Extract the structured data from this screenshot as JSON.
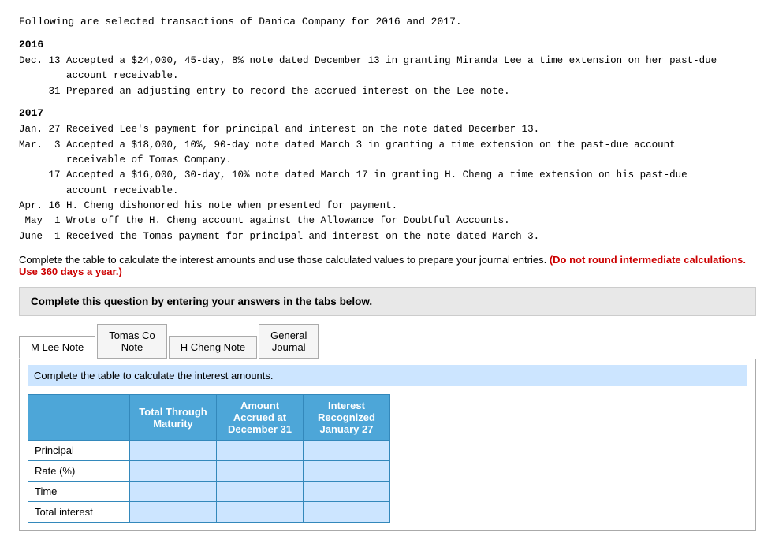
{
  "intro": "Following are selected transactions of Danica Company for 2016 and 2017.",
  "year2016": {
    "heading": "2016",
    "transactions": "Dec. 13 Accepted a $24,000, 45-day, 8% note dated December 13 in granting Miranda Lee a time extension on her past-due\n        account receivable.\n     31 Prepared an adjusting entry to record the accrued interest on the Lee note."
  },
  "year2017": {
    "heading": "2017",
    "transactions": "Jan. 27 Received Lee's payment for principal and interest on the note dated December 13.\nMar.  3 Accepted a $18,000, 10%, 90-day note dated March 3 in granting a time extension on the past-due account\n        receivable of Tomas Company.\n     17 Accepted a $16,000, 30-day, 10% note dated March 17 in granting H. Cheng a time extension on his past-due\n        account receivable.\nApr. 16 H. Cheng dishonored his note when presented for payment.\n May  1 Wrote off the H. Cheng account against the Allowance for Doubtful Accounts.\nJune  1 Received the Tomas payment for principal and interest on the note dated March 3."
  },
  "instruction_text": "Complete the table to calculate the interest amounts and use those calculated values to prepare your journal entries.",
  "instruction_red": "(Do not round intermediate calculations. Use 360 days a year.)",
  "gray_box_text": "Complete this question by entering your answers in the tabs below.",
  "tabs": [
    {
      "label": "M Lee Note",
      "active": true
    },
    {
      "label": "Tomas Co\nNote",
      "active": false
    },
    {
      "label": "H Cheng Note",
      "active": false
    },
    {
      "label": "General\nJournal",
      "active": false
    }
  ],
  "blue_instruction": "Complete the table to calculate the interest amounts.",
  "table": {
    "headers": [
      "",
      "Total Through\nMaturity",
      "Amount\nAccrued at\nDecember 31",
      "Interest\nRecognized\nJanuary 27"
    ],
    "rows": [
      {
        "label": "Principal",
        "col1": "",
        "col2": "",
        "col3": ""
      },
      {
        "label": "Rate (%)",
        "col1": "",
        "col2": "",
        "col3": ""
      },
      {
        "label": "Time",
        "col1": "",
        "col2": "",
        "col3": ""
      },
      {
        "label": "Total interest",
        "col1": "",
        "col2": "",
        "col3": ""
      }
    ]
  }
}
